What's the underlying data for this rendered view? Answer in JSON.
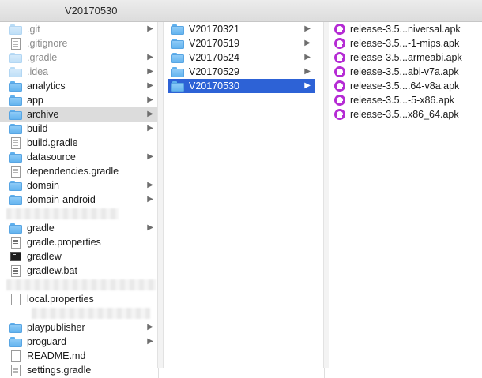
{
  "window": {
    "title": "V20170530"
  },
  "column1": {
    "items": [
      {
        "label": ".git",
        "icon": "folder-icon",
        "pale": true,
        "arrow": true
      },
      {
        "label": ".gitignore",
        "icon": "document-icon",
        "pale": true,
        "arrow": false
      },
      {
        "label": ".gradle",
        "icon": "folder-icon",
        "pale": true,
        "arrow": true
      },
      {
        "label": ".idea",
        "icon": "folder-icon",
        "pale": true,
        "arrow": true
      },
      {
        "label": "analytics",
        "icon": "folder-icon",
        "pale": false,
        "arrow": true
      },
      {
        "label": "app",
        "icon": "folder-icon",
        "pale": false,
        "arrow": true
      },
      {
        "label": "archive",
        "icon": "folder-icon",
        "pale": false,
        "arrow": true,
        "selected": true
      },
      {
        "label": "build",
        "icon": "folder-icon",
        "pale": false,
        "arrow": true
      },
      {
        "label": "build.gradle",
        "icon": "document-icon",
        "pale": false,
        "arrow": false
      },
      {
        "label": "datasource",
        "icon": "folder-icon",
        "pale": false,
        "arrow": true
      },
      {
        "label": "dependencies.gradle",
        "icon": "document-icon",
        "pale": false,
        "arrow": false
      },
      {
        "label": "domain",
        "icon": "folder-icon",
        "pale": false,
        "arrow": true
      },
      {
        "label": "domain-android",
        "icon": "folder-icon",
        "pale": false,
        "arrow": true
      },
      {
        "redacted": true
      },
      {
        "label": "gradle",
        "icon": "folder-icon",
        "pale": false,
        "arrow": true
      },
      {
        "label": "gradle.properties",
        "icon": "text-document-icon",
        "pale": false,
        "arrow": false
      },
      {
        "label": "gradlew",
        "icon": "terminal-icon",
        "pale": false,
        "arrow": false
      },
      {
        "label": "gradlew.bat",
        "icon": "text-document-icon",
        "pale": false,
        "arrow": false
      },
      {
        "redacted": true
      },
      {
        "label": "local.properties",
        "icon": "blank-document-icon",
        "pale": false,
        "arrow": false
      },
      {
        "redacted": true
      },
      {
        "label": "playpublisher",
        "icon": "folder-icon",
        "pale": false,
        "arrow": true
      },
      {
        "label": "proguard",
        "icon": "folder-icon",
        "pale": false,
        "arrow": true
      },
      {
        "label": "README.md",
        "icon": "blank-document-icon",
        "pale": false,
        "arrow": false
      },
      {
        "label": "settings.gradle",
        "icon": "document-icon",
        "pale": false,
        "arrow": false
      }
    ]
  },
  "column2": {
    "items": [
      {
        "label": "V20170321",
        "icon": "folder-icon",
        "arrow": true
      },
      {
        "label": "V20170519",
        "icon": "folder-icon",
        "arrow": true
      },
      {
        "label": "V20170524",
        "icon": "folder-icon",
        "arrow": true
      },
      {
        "label": "V20170529",
        "icon": "folder-icon",
        "arrow": true
      },
      {
        "label": "V20170530",
        "icon": "folder-icon",
        "arrow": true,
        "selected": true
      }
    ]
  },
  "column3": {
    "items": [
      {
        "label": "release-3.5...niversal.apk",
        "icon": "android-apk-icon"
      },
      {
        "label": "release-3.5...-1-mips.apk",
        "icon": "android-apk-icon"
      },
      {
        "label": "release-3.5...armeabi.apk",
        "icon": "android-apk-icon"
      },
      {
        "label": "release-3.5...abi-v7a.apk",
        "icon": "android-apk-icon"
      },
      {
        "label": "release-3.5....64-v8a.apk",
        "icon": "android-apk-icon"
      },
      {
        "label": "release-3.5...-5-x86.apk",
        "icon": "android-apk-icon"
      },
      {
        "label": "release-3.5...x86_64.apk",
        "icon": "android-apk-icon"
      }
    ]
  },
  "chevron_glyph": "▶"
}
